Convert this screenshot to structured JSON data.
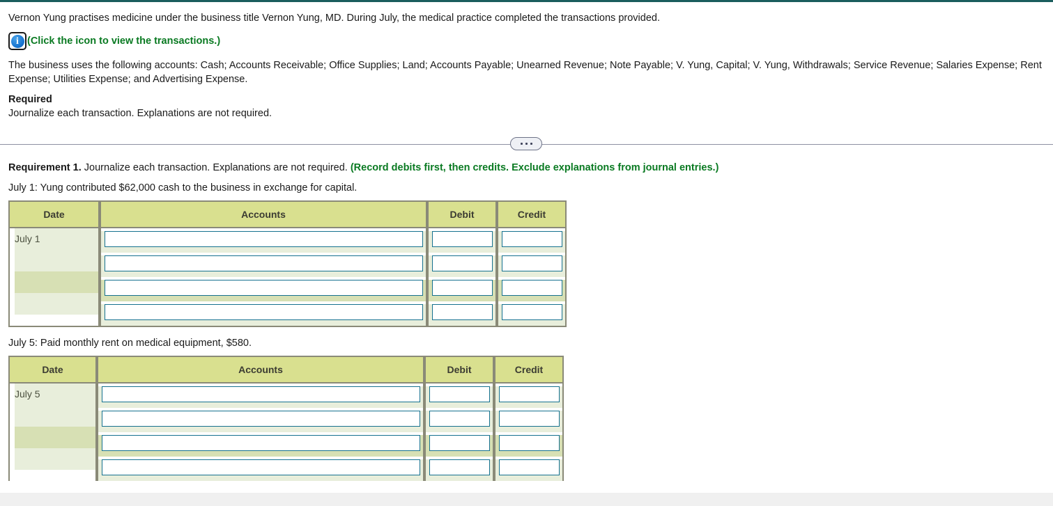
{
  "document": {
    "intro_paragraph": "Vernon Yung practises medicine under the business title Vernon Yung, MD. During July, the medical practice completed the transactions provided.",
    "icon_caption": "(Click the icon to view the transactions.)",
    "icon_name": "info-icon",
    "info_icon_glyph": "i",
    "accounts_paragraph": "The business uses the following accounts: Cash; Accounts Receivable; Office Supplies; Land; Accounts Payable; Unearned Revenue; Note Payable; V. Yung, Capital; V. Yung, Withdrawals; Service Revenue; Salaries Expense; Rent Expense; Utilities Expense; and Advertising Expense.",
    "required_heading": "Required",
    "required_text": "Journalize each transaction. Explanations are not required."
  },
  "divider": {
    "expand_label": "•••"
  },
  "requirement": {
    "label": "Requirement 1.",
    "text": " Journalize each transaction. Explanations are not required. ",
    "instruction": "(Record debits first, then credits. Exclude explanations from journal entries.)"
  },
  "colors": {
    "top_rule": "#1a5d5d",
    "header_fill": "#d9e08f",
    "band_dark": "#d7e0b4",
    "band_light": "#e8eedb",
    "table_border": "#8a8a78",
    "input_border": "#15718f",
    "green_text": "#0a7a22"
  },
  "table_headers": {
    "date": "Date",
    "accounts": "Accounts",
    "debit": "Debit",
    "credit": "Credit"
  },
  "entries": [
    {
      "transaction_text": "July 1: Yung contributed $62,000 cash to the business in exchange for capital.",
      "date": "July 1",
      "rows": [
        {
          "accounts": "",
          "debit": "",
          "credit": ""
        },
        {
          "accounts": "",
          "debit": "",
          "credit": ""
        },
        {
          "accounts": "",
          "debit": "",
          "credit": ""
        },
        {
          "accounts": "",
          "debit": "",
          "credit": ""
        }
      ]
    },
    {
      "transaction_text": "July 5: Paid monthly rent on medical equipment, $580.",
      "date": "July 5",
      "rows": [
        {
          "accounts": "",
          "debit": "",
          "credit": ""
        },
        {
          "accounts": "",
          "debit": "",
          "credit": ""
        },
        {
          "accounts": "",
          "debit": "",
          "credit": ""
        },
        {
          "accounts": "",
          "debit": "",
          "credit": ""
        }
      ]
    }
  ]
}
